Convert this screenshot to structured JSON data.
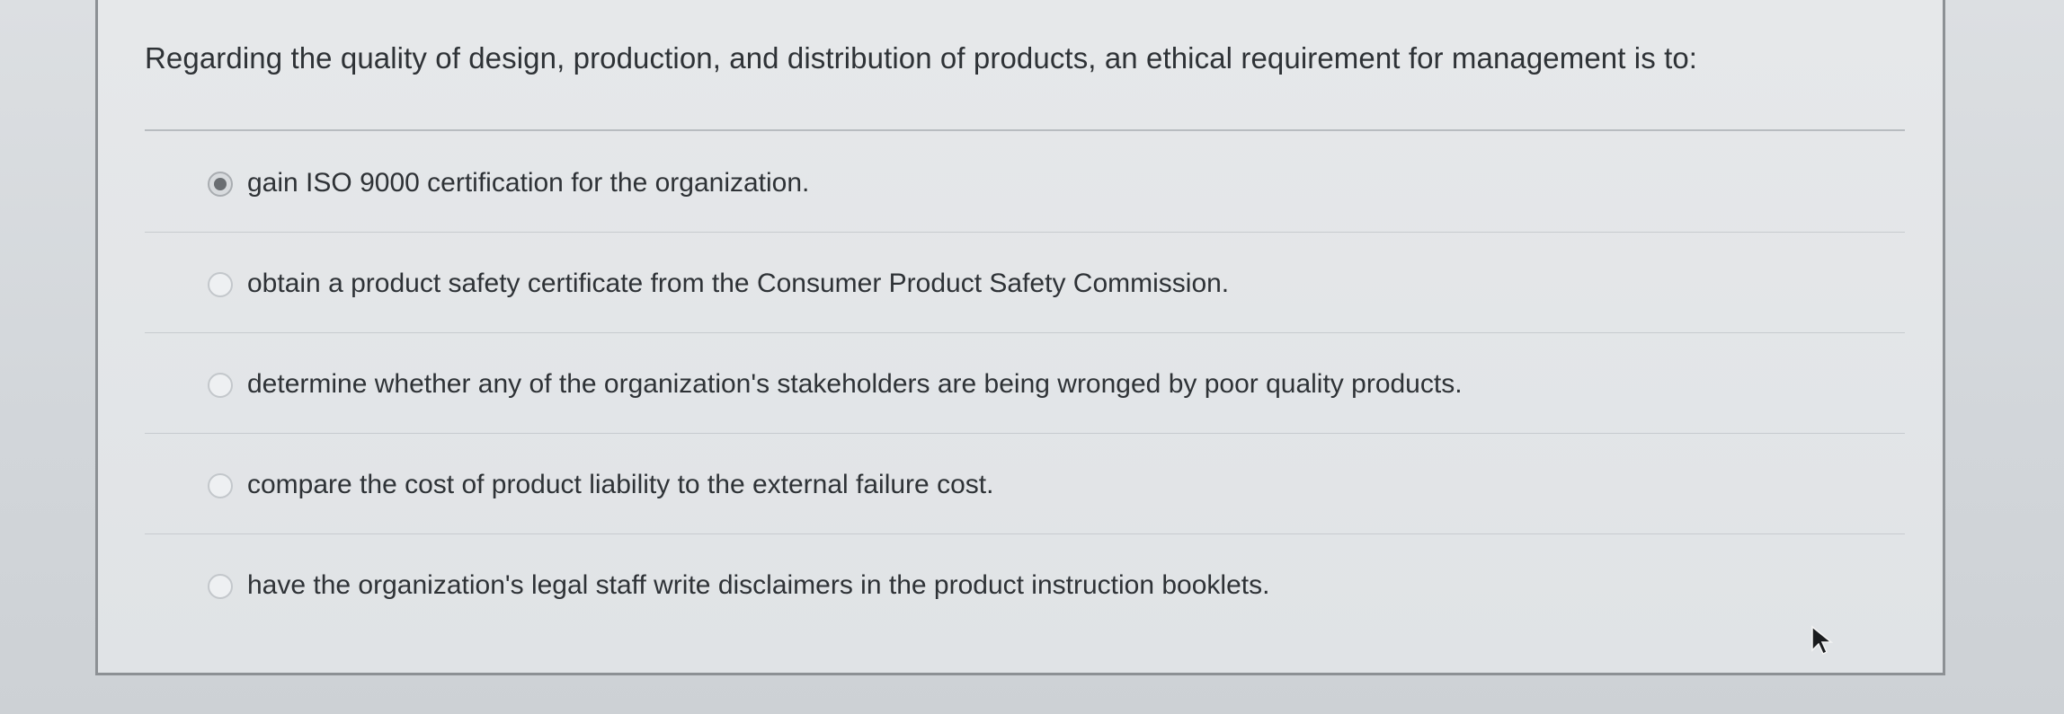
{
  "question": {
    "text": "Regarding the quality of design, production, and distribution of products, an ethical requirement for management is to:"
  },
  "options": [
    {
      "label": "gain ISO 9000 certification for the organization.",
      "selected": true
    },
    {
      "label": "obtain a product safety certificate from the Consumer Product Safety Commission.",
      "selected": false
    },
    {
      "label": "determine whether any of the organization's stakeholders are being wronged by poor quality products.",
      "selected": false
    },
    {
      "label": "compare the cost of product liability to the external failure cost.",
      "selected": false
    },
    {
      "label": "have the organization's legal staff write disclaimers in the product instruction booklets.",
      "selected": false
    }
  ],
  "icons": {
    "cursor": "mouse-pointer-icon"
  },
  "colors": {
    "text": "#2e3236",
    "background": "#d6d9dc",
    "card_border": "#8c9094",
    "radio_selected": "#6a6e72"
  }
}
